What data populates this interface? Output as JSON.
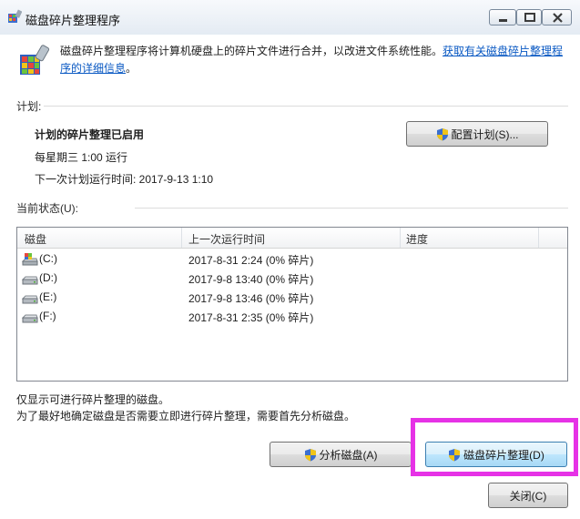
{
  "window": {
    "title": "磁盘碎片整理程序",
    "description": "磁盘碎片整理程序将计算机硬盘上的碎片文件进行合并，以改进文件系统性能。",
    "link_text": "获取有关磁盘碎片整理程序的详细信息",
    "link_suffix": "。"
  },
  "schedule": {
    "section_label": "计划:",
    "status": "计划的碎片整理已启用",
    "frequency": "每星期三  1:00 运行",
    "next_run": "下一次计划运行时间: 2017-9-13 1:10",
    "configure_button": "配置计划(S)..."
  },
  "current_status": {
    "section_label": "当前状态(U):",
    "columns": [
      "磁盘",
      "上一次运行时间",
      "进度"
    ],
    "rows": [
      {
        "disk": "(C:)",
        "last_run": "2017-8-31 2:24 (0% 碎片)",
        "progress": "",
        "icon": "system-drive-icon"
      },
      {
        "disk": "(D:)",
        "last_run": "2017-9-8 13:40 (0% 碎片)",
        "progress": "",
        "icon": "drive-icon"
      },
      {
        "disk": "(E:)",
        "last_run": "2017-9-8 13:46 (0% 碎片)",
        "progress": "",
        "icon": "drive-icon"
      },
      {
        "disk": "(F:)",
        "last_run": "2017-8-31 2:35 (0% 碎片)",
        "progress": "",
        "icon": "drive-icon"
      }
    ]
  },
  "notes": {
    "line1": "仅显示可进行碎片整理的磁盘。",
    "line2": "为了最好地确定磁盘是否需要立即进行碎片整理，需要首先分析磁盘。"
  },
  "buttons": {
    "analyze": "分析磁盘(A)",
    "defrag": "磁盘碎片整理(D)",
    "close": "关闭(C)"
  },
  "colors": {
    "highlight": "#e632e6",
    "link": "#0a59c3"
  }
}
